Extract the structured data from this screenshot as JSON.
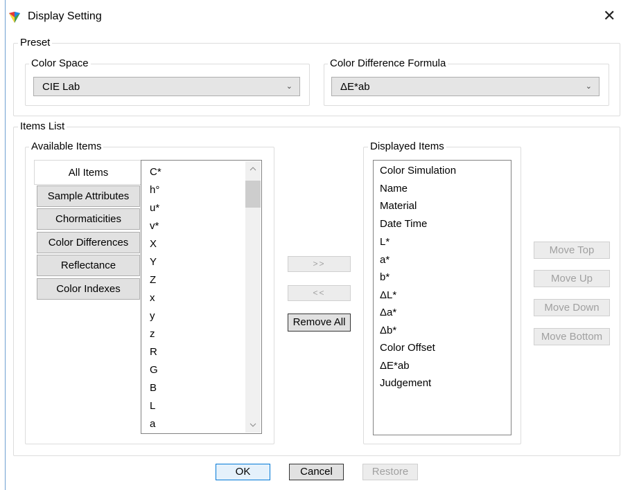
{
  "window": {
    "title": "Display Setting",
    "close_glyph": "✕"
  },
  "preset": {
    "legend": "Preset",
    "color_space": {
      "legend": "Color Space",
      "value": "CIE Lab"
    },
    "formula": {
      "legend": "Color Difference Formula",
      "value": "ΔE*ab"
    }
  },
  "items_list": {
    "legend": "Items List",
    "available": {
      "legend": "Available Items",
      "tabs": [
        "All Items",
        "Sample Attributes",
        "Chormaticities",
        "Color Differences",
        "Reflectance",
        "Color Indexes"
      ],
      "items": [
        "C*",
        "h°",
        "u*",
        "v*",
        "X",
        "Y",
        "Z",
        "x",
        "y",
        "z",
        "R",
        "G",
        "B",
        "L",
        "a"
      ]
    },
    "transfer": {
      "add_label": ">>",
      "remove_label": "<<",
      "remove_all_label": "Remove All"
    },
    "displayed": {
      "legend": "Displayed Items",
      "items": [
        "Color Simulation",
        "Name",
        "Material",
        "Date Time",
        "L*",
        "a*",
        "b*",
        "ΔL*",
        "Δa*",
        "Δb*",
        "Color Offset",
        "ΔE*ab",
        "Judgement"
      ]
    },
    "move": {
      "top": "Move Top",
      "up": "Move Up",
      "down": "Move Down",
      "bottom": "Move Bottom"
    }
  },
  "footer": {
    "ok": "OK",
    "cancel": "Cancel",
    "restore": "Restore"
  }
}
